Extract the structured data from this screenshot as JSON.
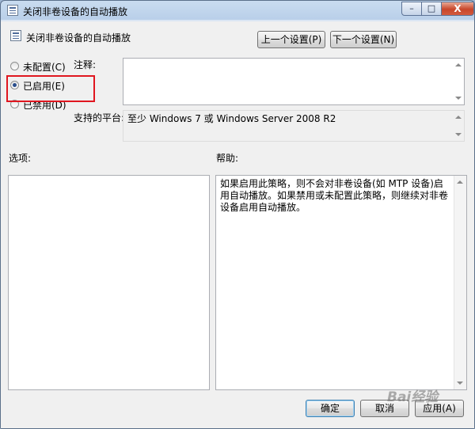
{
  "window": {
    "title": "关闭非卷设备的自动播放",
    "caption_buttons": {
      "minimize": "–",
      "maximize": "□",
      "close": "X"
    }
  },
  "header": {
    "setting_name": "关闭非卷设备的自动播放",
    "prev_button": "上一个设置(P)",
    "next_button": "下一个设置(N)"
  },
  "state": {
    "options": [
      {
        "label": "未配置(C)",
        "selected": false
      },
      {
        "label": "已启用(E)",
        "selected": true
      },
      {
        "label": "已禁用(D)",
        "selected": false
      }
    ],
    "highlight_color": "#e0161f"
  },
  "comment": {
    "label": "注释:",
    "value": ""
  },
  "platform": {
    "label": "支持的平台:",
    "value": "至少 Windows 7 或 Windows Server 2008 R2"
  },
  "options_section": {
    "label": "选项:"
  },
  "help_section": {
    "label": "帮助:",
    "text": "如果启用此策略，则不会对非卷设备(如 MTP 设备)启用自动播放。如果禁用或未配置此策略，则继续对非卷设备启用自动播放。"
  },
  "footer": {
    "ok": "确定",
    "cancel": "取消",
    "apply": "应用(A)"
  },
  "watermark": "Bai经验"
}
